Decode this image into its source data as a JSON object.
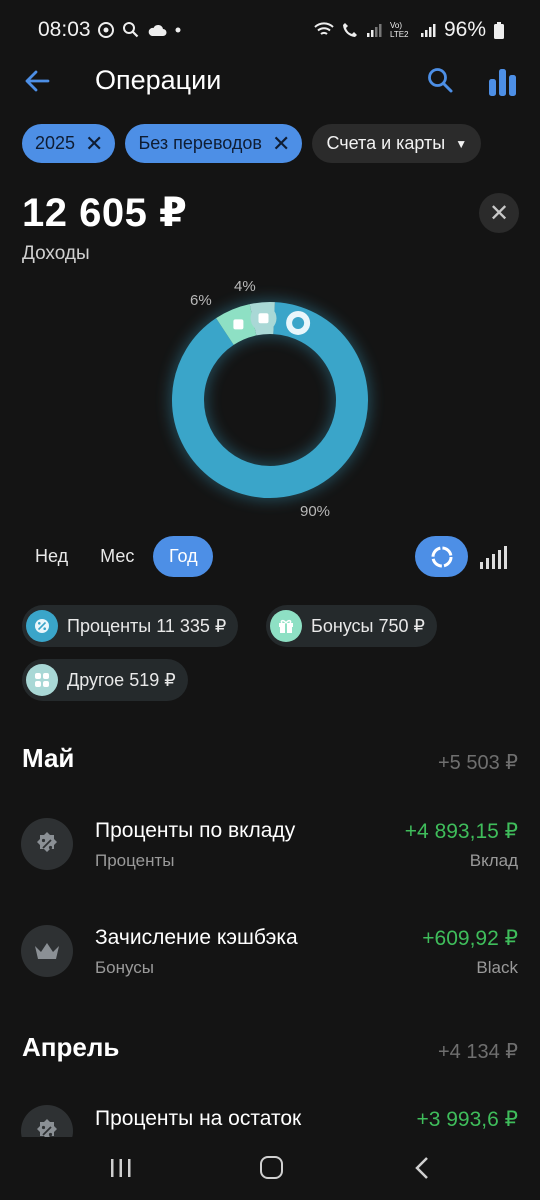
{
  "status_bar": {
    "time": "08:03",
    "battery": "96%",
    "network_label": "Vo) LTE2"
  },
  "header": {
    "title": "Операции"
  },
  "filters": {
    "year": "2025",
    "no_transfers": "Без переводов",
    "accounts": "Счета и карты"
  },
  "summary": {
    "total": "12 605 ₽",
    "label": "Доходы"
  },
  "chart_data": {
    "type": "pie",
    "categories": [
      "Проценты",
      "Бонусы",
      "Другое"
    ],
    "values": [
      11335,
      750,
      519
    ],
    "percent_labels": [
      "90%",
      "6%",
      "4%"
    ],
    "colors": [
      "#3aa5c9",
      "#8ee0c4",
      "#a9d8d6"
    ]
  },
  "period": {
    "week": "Нед",
    "month": "Мес",
    "year": "Год",
    "selected": "Год"
  },
  "categories": [
    {
      "label": "Проценты 11 335 ₽",
      "icon": "percent-badge-icon",
      "color": "#3aa5c9"
    },
    {
      "label": "Бонусы 750 ₽",
      "icon": "gift-icon",
      "color": "#8ee0c4"
    },
    {
      "label": "Другое 519 ₽",
      "icon": "grid-icon",
      "color": "#a9d8d6"
    }
  ],
  "groups": [
    {
      "title": "Май",
      "sum": "+5 503 ₽",
      "items": [
        {
          "title": "Проценты по вкладу",
          "category": "Проценты",
          "amount": "+4 893,15 ₽",
          "account": "Вклад",
          "icon": "percent-badge-icon"
        },
        {
          "title": "Зачисление кэшбэка",
          "category": "Бонусы",
          "amount": "+609,92 ₽",
          "account": "Black",
          "icon": "crown-icon"
        }
      ]
    },
    {
      "title": "Апрель",
      "sum": "+4 134 ₽",
      "items": [
        {
          "title": "Проценты на остаток",
          "category": "",
          "amount": "+3 993,6 ₽",
          "account": "",
          "icon": "percent-badge-icon"
        }
      ]
    }
  ]
}
